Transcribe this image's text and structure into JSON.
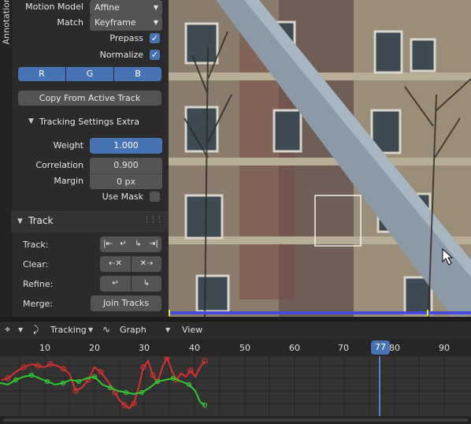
{
  "sidebar_tab": {
    "label": "Annotation"
  },
  "settings": {
    "motion_model": {
      "label": "Motion Model",
      "value": "Affine"
    },
    "match": {
      "label": "Match",
      "value": "Keyframe"
    },
    "prepass": {
      "label": "Prepass",
      "checked": true
    },
    "normalize": {
      "label": "Normalize",
      "checked": true
    },
    "channels": [
      "R",
      "G",
      "B"
    ],
    "copy_button": "Copy From Active Track"
  },
  "extra": {
    "title": "Tracking Settings Extra",
    "weight": {
      "label": "Weight",
      "value": "1.000"
    },
    "correlation": {
      "label": "Correlation",
      "value": "0.900"
    },
    "margin": {
      "label": "Margin",
      "value": "0 px"
    },
    "use_mask": {
      "label": "Use Mask",
      "checked": false
    }
  },
  "track_panel": {
    "title": "Track",
    "track_label": "Track:",
    "clear_label": "Clear:",
    "refine_label": "Refine:",
    "merge_label": "Merge:",
    "join_button": "Join Tracks"
  },
  "timeline": {
    "tracking_menu": "Tracking",
    "graph_menu": "Graph",
    "view_menu": "View",
    "ruler_ticks": [
      "10",
      "20",
      "30",
      "40",
      "50",
      "60",
      "70",
      "80",
      "90"
    ],
    "current_frame": "77"
  },
  "colors": {
    "accent": "#4772b3",
    "playhead": "#5680c2",
    "curve_red": "#d83030",
    "curve_green": "#30c830"
  }
}
